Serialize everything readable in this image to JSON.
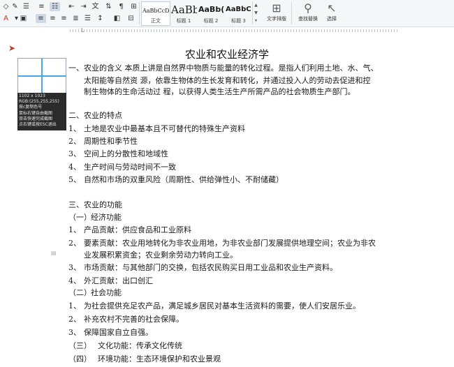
{
  "ribbon": {
    "styles": [
      {
        "sample": "AaBbCcDd",
        "label": "正文"
      },
      {
        "sample": "AaBb",
        "label": "标题 1"
      },
      {
        "sample": "AaBb(",
        "label": "标题 2"
      },
      {
        "sample": "AaBbC",
        "label": "标题 3"
      }
    ],
    "text_layout_label": "文字排版",
    "find_replace_label": "查找替换",
    "select_label": "选择"
  },
  "ruler": {
    "left_mark": "L"
  },
  "document": {
    "title": "农业和农业经济学",
    "lines": [
      {
        "num": "",
        "text": "一、农业的含义  本质上讲是自然界中物质与能量的转化过程。是指人们利用土地、水、气、"
      },
      {
        "num": "",
        "text": "太阳能等自然资  源，依靠生物体的生长发育和转化，并通过投入人的劳动去促进和控"
      },
      {
        "num": "",
        "text": "制生物体的生命活动过  程，以获得人类生活生产所需产品的社会物质生产部门。"
      },
      {
        "num": "",
        "text": "二、农业的特点"
      },
      {
        "num": "1、",
        "text": "土地是农业中最基本且不可替代的特殊生产资料"
      },
      {
        "num": "2、",
        "text": "周期性和季节性"
      },
      {
        "num": "3、",
        "text": "空间上的分散性和地域性"
      },
      {
        "num": "4、",
        "text": "生产时间与劳动时间不一致"
      },
      {
        "num": "5、",
        "text": "自然和市场的双重风险（周期性、供给弹性小、不耐储藏）"
      },
      {
        "num": "",
        "text": "三、农业的功能"
      },
      {
        "num": "（一）",
        "text": "经济功能"
      },
      {
        "num": "1、",
        "text": "产品贡献：供应食品和工业原料"
      },
      {
        "num": "2、",
        "text": "要素贡献：农业用地转化为非农业用地，为非农业部门发展提供地理空间；农业为非农"
      },
      {
        "num": "",
        "text": "业发展积累资金；农业剩余劳动力转向工业。"
      },
      {
        "num": "3、",
        "text": "市场贡献：与其他部门的交换，包括农民购买日用工业品和农业生产资料。"
      },
      {
        "num": "4、",
        "text": "外汇贡献：出口创汇"
      },
      {
        "num": "（二）",
        "text": "社会功能"
      },
      {
        "num": "1、",
        "text": "为社会提供充足农产品，满足城乡居民对基本生活资料的需要，使人们安居乐业。"
      },
      {
        "num": "2、",
        "text": "补充农村不完善的社会保障。"
      },
      {
        "num": "3、",
        "text": "保障国家自立自强。"
      },
      {
        "num": "（三）",
        "text": "文化功能：传承文化传统"
      },
      {
        "num": "（四）",
        "text": "环境功能：生态环境保护和农业景观"
      }
    ]
  },
  "capture": {
    "size": "1102 x 1023",
    "rgb": "RGB:(255,255,255)",
    "hint_copy": "按c复制色号",
    "hint_drag": "鼠标右键自由截图",
    "hint_dblclick": "双击快速完成截图",
    "hint_esc": "点右键或按ESC退出"
  },
  "colors": {
    "crosshair": "#47a7e8",
    "info_bg": "#2b2b2b"
  }
}
